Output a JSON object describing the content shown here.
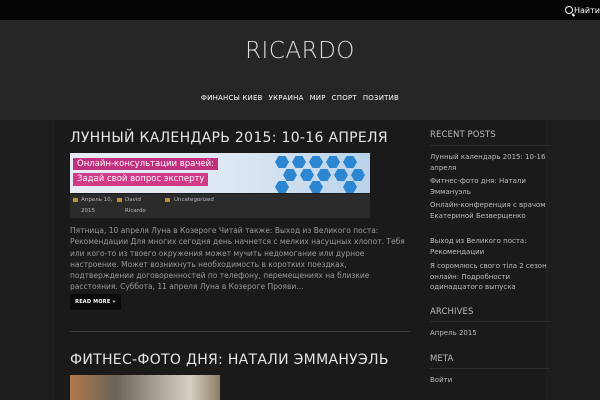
{
  "topbar": {
    "search_label": "Найти"
  },
  "header": {
    "site_title": "RICARDO"
  },
  "nav": [
    "ФИНАНСЫ КИЕВ",
    "УКРАИНА",
    "МИР",
    "СПОРТ",
    "ПОЗИТИВ"
  ],
  "posts": [
    {
      "title": "ЛУННЫЙ КАЛЕНДАРЬ 2015: 10-16 АПРЕЛЯ",
      "banner": {
        "line1": "Онлайн-консультации врачей:",
        "line2": "Задай свой вопрос эксперту"
      },
      "meta": {
        "date_line1": "Апрель 10,",
        "date_line2": "2015",
        "author_line1": "David",
        "author_line2": "Ricardo",
        "category": "Uncategorized"
      },
      "excerpt": "Пятница, 10 апреля Луна в Козероге Читай также: Выход из Великого поста: Рекомендации Для многих сегодня день начнется с мелких насущных хлопот. Тебя или кого-то из твоего окружения может мучить недомогание или дурное настроение. Может возникнуть необходимость в коротких поездках, подтверждении договоренностей по телефону, перемещениях на близкие расстояния. Суббота, 11 апреля Луна в Козероге Прояви…",
      "read_more": "READ MORE »"
    },
    {
      "title": "ФИТНЕС-ФОТО ДНЯ: НАТАЛИ ЭММАНУЭЛЬ"
    }
  ],
  "sidebar": {
    "recent_title": "RECENT POSTS",
    "recent": [
      "Лунный календарь 2015: 10-16 апреля",
      "Фитнес-фото дня: Натали Эммануэль",
      "Онлайн-конференция с врачом Екатериной Безверщенко",
      "Выход из Великого поста: Рекомендации",
      "Я соромлюсь свого тіла 2 сезон онлайн: Подробности одинадцатого выпуска"
    ],
    "archives_title": "ARCHIVES",
    "archives": [
      "Апрель 2015"
    ],
    "meta_title": "META",
    "meta": [
      "Войти"
    ]
  },
  "colors": {
    "page_bg": "#1e1e1e",
    "header_bg": "#262626",
    "banner_pink": "#c0307f",
    "meta_icon": "#b8913a"
  }
}
